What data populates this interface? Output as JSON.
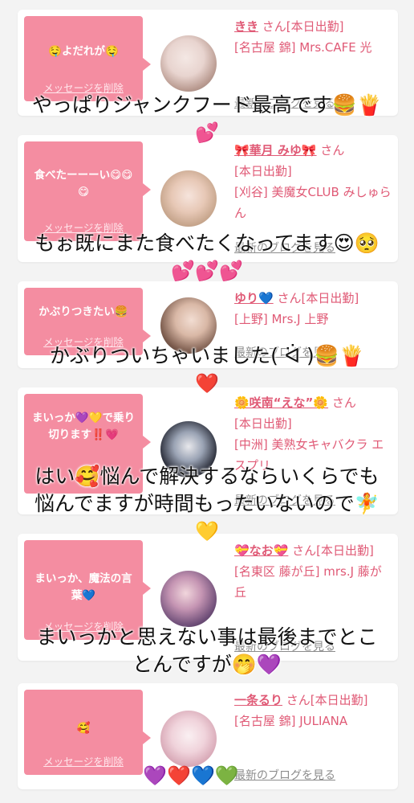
{
  "delete_label": "メッセージを削除",
  "blog_label": "最新のブログを見る",
  "cards": [
    {
      "name": "きき",
      "suffix": "さん[本日出勤]",
      "shop": "[名古屋 錦] Mrs.CAFE 光",
      "message": "🤤よだれが🤤"
    },
    {
      "name": "🎀華月 みゆ🎀",
      "suffix": "さん",
      "status": "[本日出勤]",
      "shop": "[刈谷] 美魔女CLUB みしゅらん",
      "message": "食べたーーーい😋😋😋"
    },
    {
      "name": "ゆり💙",
      "suffix": "さん[本日出勤]",
      "shop": "[上野] Mrs.J 上野",
      "message": "かぶりつきたい🍔"
    },
    {
      "name": "🌼咲南“えな”🌼",
      "suffix": "さん",
      "status": "[本日出勤]",
      "shop": "[中洲] 美熟女キャバクラ エスプリ",
      "message": "まいっか💜💛で乗り切ります‼️💗"
    },
    {
      "name": "💝なお💝",
      "suffix": "さん[本日出勤]",
      "shop": "[名東区 藤が丘] mrs.J 藤が丘",
      "message": "まいっか、魔法の言葉💙"
    },
    {
      "name": "一条るり",
      "suffix": "さん[本日出勤]",
      "shop": "[名古屋 錦] JULIANA",
      "message": "🥰"
    }
  ],
  "overlays": {
    "o1": "やっぱりジャンクフード最高です🍔🍟",
    "o1b": "💕",
    "o2": "もぉ既にまた食べたくなってます😍🥺",
    "o2b": "💕💕💕",
    "o3": "かぶりついちゃいました( ᐛ )🍔🍟",
    "o3b": "❤️",
    "o4": "はい🥰悩んで解決するならいくらでも",
    "o4b": "悩んでますが時間もったいないので🧚",
    "o4c": "💛",
    "o5": "まいっかと思えない事は最後までとこ",
    "o5b": "とんですが🤭💜",
    "o6": "💜❤️💙💚"
  }
}
